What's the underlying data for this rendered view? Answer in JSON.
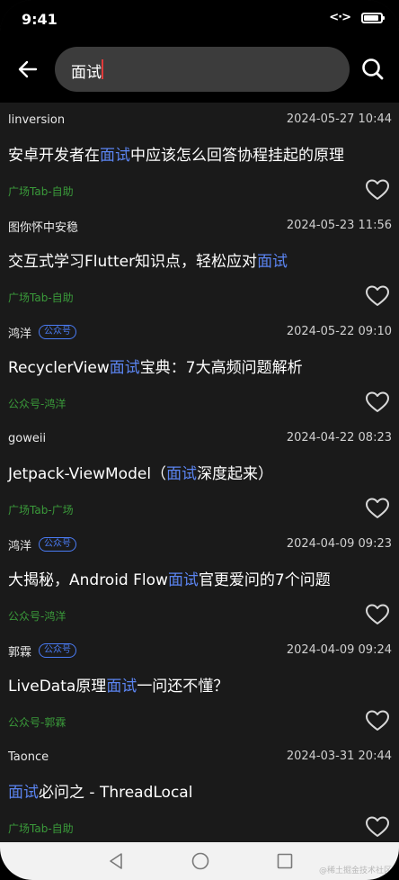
{
  "status": {
    "time": "9:41",
    "network": "<·>"
  },
  "header": {
    "search_value": "面试"
  },
  "items": [
    {
      "author": "linversion",
      "badge": "",
      "date": "2024-05-27 10:44",
      "title": [
        {
          "t": "安卓开发者在",
          "h": false
        },
        {
          "t": "面试",
          "h": true
        },
        {
          "t": "中应该怎么回答协程挂起的原理",
          "h": false
        }
      ],
      "source": "广场Tab-自助"
    },
    {
      "author": "图你怀中安稳",
      "badge": "",
      "date": "2024-05-23 11:56",
      "title": [
        {
          "t": "交互式学习Flutter知识点，轻松应对",
          "h": false
        },
        {
          "t": "面试",
          "h": true
        }
      ],
      "source": "广场Tab-自助"
    },
    {
      "author": "鸿洋",
      "badge": "公众号",
      "date": "2024-05-22 09:10",
      "title": [
        {
          "t": "RecyclerView",
          "h": false
        },
        {
          "t": "面试",
          "h": true
        },
        {
          "t": "宝典：7大高频问题解析",
          "h": false
        }
      ],
      "source": "公众号-鸿洋"
    },
    {
      "author": "goweii",
      "badge": "",
      "date": "2024-04-22 08:23",
      "title": [
        {
          "t": "Jetpack-ViewModel（",
          "h": false
        },
        {
          "t": "面试",
          "h": true
        },
        {
          "t": "深度起来）",
          "h": false
        }
      ],
      "source": "广场Tab-广场"
    },
    {
      "author": "鸿洋",
      "badge": "公众号",
      "date": "2024-04-09 09:23",
      "title": [
        {
          "t": "大揭秘，Android Flow",
          "h": false
        },
        {
          "t": "面试",
          "h": true
        },
        {
          "t": "官更爱问的7个问题",
          "h": false
        }
      ],
      "source": "公众号-鸿洋"
    },
    {
      "author": "郭霖",
      "badge": "公众号",
      "date": "2024-04-09 09:24",
      "title": [
        {
          "t": "LiveData原理",
          "h": false
        },
        {
          "t": "面试",
          "h": true
        },
        {
          "t": "一问还不懂？",
          "h": false
        }
      ],
      "source": "公众号-郭霖"
    },
    {
      "author": "Taonce",
      "badge": "",
      "date": "2024-03-31 20:44",
      "title": [
        {
          "t": "面试",
          "h": true
        },
        {
          "t": "必问之 - ThreadLocal",
          "h": false
        }
      ],
      "source": "广场Tab-自助"
    }
  ],
  "watermark": "@稀土掘金技术社区",
  "icons": {
    "back": "arrow-left-icon",
    "search": "search-icon",
    "like": "heart-outline-icon",
    "nav_back": "triangle-back-icon",
    "nav_home": "circle-home-icon",
    "nav_recent": "square-recent-icon"
  },
  "colors": {
    "highlight": "#5b84f0",
    "source": "#3a9a3a",
    "background": "#1a1a1a",
    "cursor": "#e03a3a"
  }
}
